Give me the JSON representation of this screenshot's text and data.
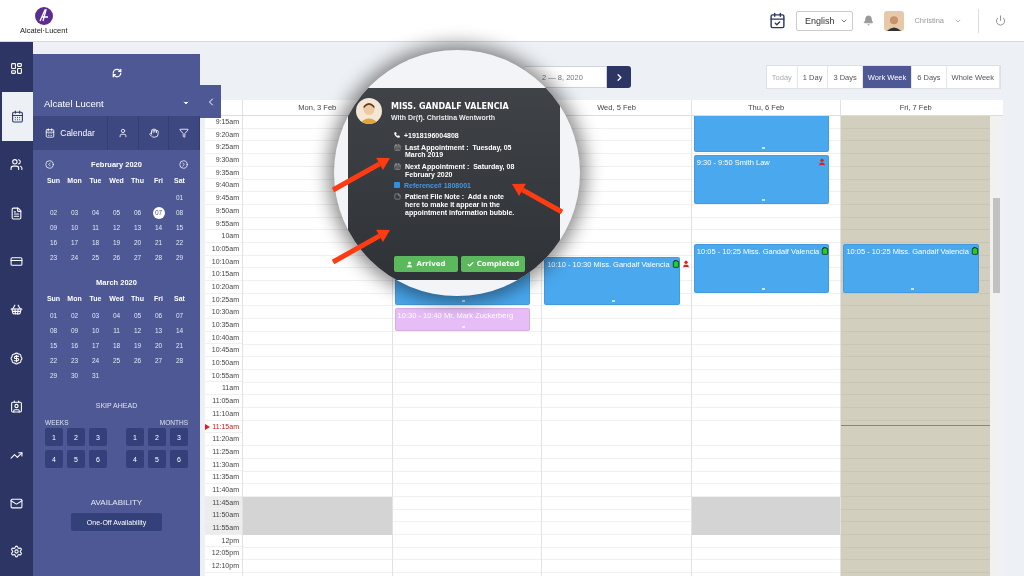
{
  "header": {
    "logo_text": "Alcatel·Lucent",
    "language": "English",
    "user": "Christina"
  },
  "nav_rail": [
    {
      "kind": "dashboard",
      "selected": false
    },
    {
      "kind": "calendar",
      "selected": true
    },
    {
      "kind": "people",
      "selected": false
    },
    {
      "kind": "list",
      "selected": false
    },
    {
      "kind": "card",
      "selected": false
    },
    {
      "kind": "basket",
      "selected": false
    },
    {
      "kind": "dollar",
      "selected": false
    },
    {
      "kind": "contact",
      "selected": false
    },
    {
      "kind": "chart",
      "selected": false
    },
    {
      "kind": "mail",
      "selected": false
    },
    {
      "kind": "settings",
      "selected": false
    }
  ],
  "side_panel": {
    "organization": "Alcatel Lucent",
    "tools": [
      {
        "kind": "calendar",
        "label": "Calendar"
      },
      {
        "kind": "person"
      },
      {
        "kind": "hand"
      },
      {
        "kind": "filter"
      }
    ],
    "mini_calendars": [
      {
        "title": "February 2020",
        "arrows": true,
        "weekdays": [
          "Sun",
          "Mon",
          "Tue",
          "Wed",
          "Thu",
          "Fri",
          "Sat"
        ],
        "weeks": [
          [
            {
              "d": "01",
              "selected": false
            }
          ],
          [
            {
              "d": "02",
              "selected": false
            },
            {
              "d": "03",
              "selected": false
            },
            {
              "d": "04",
              "selected": false
            },
            {
              "d": "05",
              "selected": false
            },
            {
              "d": "06",
              "selected": false
            },
            {
              "d": "07",
              "selected": true
            },
            {
              "d": "08",
              "selected": false
            }
          ],
          [
            {
              "d": "09",
              "selected": false
            },
            {
              "d": "10",
              "selected": false
            },
            {
              "d": "11",
              "selected": false
            },
            {
              "d": "12",
              "selected": false
            },
            {
              "d": "13",
              "selected": false
            },
            {
              "d": "14",
              "selected": false
            },
            {
              "d": "15",
              "selected": false
            }
          ],
          [
            {
              "d": "16",
              "selected": false
            },
            {
              "d": "17",
              "selected": false
            },
            {
              "d": "18",
              "selected": false
            },
            {
              "d": "19",
              "selected": false
            },
            {
              "d": "20",
              "selected": false
            },
            {
              "d": "21",
              "selected": false
            },
            {
              "d": "22",
              "selected": false
            }
          ],
          [
            {
              "d": "23",
              "selected": false
            },
            {
              "d": "24",
              "selected": false
            },
            {
              "d": "25",
              "selected": false
            },
            {
              "d": "26",
              "selected": false
            },
            {
              "d": "27",
              "selected": false
            },
            {
              "d": "28",
              "selected": false
            },
            {
              "d": "29",
              "selected": false
            }
          ]
        ]
      },
      {
        "title": "March 2020",
        "arrows": false,
        "weekdays": [
          "Sun",
          "Mon",
          "Tue",
          "Wed",
          "Thu",
          "Fri",
          "Sat"
        ],
        "weeks": [
          [
            {
              "d": "01",
              "selected": false
            },
            {
              "d": "02",
              "selected": false
            },
            {
              "d": "03",
              "selected": false
            },
            {
              "d": "04",
              "selected": false
            },
            {
              "d": "05",
              "selected": false
            },
            {
              "d": "06",
              "selected": false
            },
            {
              "d": "07",
              "selected": false
            }
          ],
          [
            {
              "d": "08",
              "selected": false
            },
            {
              "d": "09",
              "selected": false
            },
            {
              "d": "10",
              "selected": false
            },
            {
              "d": "11",
              "selected": false
            },
            {
              "d": "12",
              "selected": false
            },
            {
              "d": "13",
              "selected": false
            },
            {
              "d": "14",
              "selected": false
            }
          ],
          [
            {
              "d": "15",
              "selected": false
            },
            {
              "d": "16",
              "selected": false
            },
            {
              "d": "17",
              "selected": false
            },
            {
              "d": "18",
              "selected": false
            },
            {
              "d": "19",
              "selected": false
            },
            {
              "d": "20",
              "selected": false
            },
            {
              "d": "21",
              "selected": false
            }
          ],
          [
            {
              "d": "22",
              "selected": false
            },
            {
              "d": "23",
              "selected": false
            },
            {
              "d": "24",
              "selected": false
            },
            {
              "d": "25",
              "selected": false
            },
            {
              "d": "26",
              "selected": false
            },
            {
              "d": "27",
              "selected": false
            },
            {
              "d": "28",
              "selected": false
            }
          ],
          [
            {
              "d": "29",
              "selected": false
            },
            {
              "d": "30",
              "selected": false
            },
            {
              "d": "31",
              "selected": false
            }
          ]
        ]
      }
    ],
    "skip_ahead": {
      "title": "SKIP AHEAD",
      "weeks_label": "WEEKS",
      "months_label": "MONTHS",
      "weeks": [
        "1",
        "2",
        "3",
        "4",
        "5",
        "6"
      ],
      "months": [
        "1",
        "2",
        "3",
        "4",
        "5",
        "6"
      ]
    },
    "availability": {
      "title": "AVAILABILITY",
      "button": "One-Off Availability"
    }
  },
  "toolbar": {
    "date_range": "2 — 8, 2020",
    "views": [
      {
        "label": "Today",
        "selected": false,
        "disabled": true
      },
      {
        "label": "1 Day",
        "selected": false,
        "disabled": false
      },
      {
        "label": "3 Days",
        "selected": false,
        "disabled": false
      },
      {
        "label": "Work Week",
        "selected": true,
        "disabled": false
      },
      {
        "label": "6 Days",
        "selected": false,
        "disabled": false
      },
      {
        "label": "Whole Week",
        "selected": false,
        "disabled": false
      }
    ]
  },
  "calendar": {
    "times": [
      {
        "label": "9:15am",
        "current": false,
        "blocked": false
      },
      {
        "label": "9:20am",
        "current": false,
        "blocked": false
      },
      {
        "label": "9:25am",
        "current": false,
        "blocked": false
      },
      {
        "label": "9:30am",
        "current": false,
        "blocked": false
      },
      {
        "label": "9:35am",
        "current": false,
        "blocked": false
      },
      {
        "label": "9:40am",
        "current": false,
        "blocked": false
      },
      {
        "label": "9:45am",
        "current": false,
        "blocked": false
      },
      {
        "label": "9:50am",
        "current": false,
        "blocked": false
      },
      {
        "label": "9:55am",
        "current": false,
        "blocked": false
      },
      {
        "label": "10am",
        "current": false,
        "blocked": false
      },
      {
        "label": "10:05am",
        "current": false,
        "blocked": false
      },
      {
        "label": "10:10am",
        "current": false,
        "blocked": false
      },
      {
        "label": "10:15am",
        "current": false,
        "blocked": false
      },
      {
        "label": "10:20am",
        "current": false,
        "blocked": false
      },
      {
        "label": "10:25am",
        "current": false,
        "blocked": false
      },
      {
        "label": "10:30am",
        "current": false,
        "blocked": false
      },
      {
        "label": "10:35am",
        "current": false,
        "blocked": false
      },
      {
        "label": "10:40am",
        "current": false,
        "blocked": false
      },
      {
        "label": "10:45am",
        "current": false,
        "blocked": false
      },
      {
        "label": "10:50am",
        "current": false,
        "blocked": false
      },
      {
        "label": "10:55am",
        "current": false,
        "blocked": false
      },
      {
        "label": "11am",
        "current": false,
        "blocked": false
      },
      {
        "label": "11:05am",
        "current": false,
        "blocked": false
      },
      {
        "label": "11:10am",
        "current": false,
        "blocked": false
      },
      {
        "label": "11:15am",
        "current": true,
        "blocked": false
      },
      {
        "label": "11:20am",
        "current": false,
        "blocked": false
      },
      {
        "label": "11:25am",
        "current": false,
        "blocked": false
      },
      {
        "label": "11:30am",
        "current": false,
        "blocked": false
      },
      {
        "label": "11:35am",
        "current": false,
        "blocked": false
      },
      {
        "label": "11:40am",
        "current": false,
        "blocked": false
      },
      {
        "label": "11:45am",
        "current": false,
        "blocked": true
      },
      {
        "label": "11:50am",
        "current": false,
        "blocked": true
      },
      {
        "label": "11:55am",
        "current": false,
        "blocked": true
      },
      {
        "label": "12pm",
        "current": false,
        "blocked": false
      },
      {
        "label": "12:05pm",
        "current": false,
        "blocked": false
      },
      {
        "label": "12:10pm",
        "current": false,
        "blocked": false
      }
    ],
    "days": [
      {
        "label": "Mon, 3 Feb",
        "unavailable": false,
        "shows_blocked": true
      },
      {
        "unavailable": false,
        "shows_blocked": false,
        "events": [
          {
            "kind": "continued",
            "color": "#4aa8ee"
          },
          {
            "kind": "appointment",
            "time": "10:30 - 10:40",
            "title": "Mr. Mark Zuckerberg",
            "color": "#e6bdf7"
          }
        ]
      },
      {
        "label": "Wed, 5 Feb",
        "unavailable": false,
        "shows_blocked": false,
        "events": [
          {
            "kind": "appointment",
            "time": "10:10 - 10:30",
            "title": "Miss. Gandalf Valencia",
            "color": "#4aa8ee",
            "badges": [
              {
                "kind": "clipboard"
              },
              {
                "kind": "person"
              }
            ]
          }
        ]
      },
      {
        "label": "Thu, 6 Feb",
        "unavailable": false,
        "shows_blocked": true,
        "events": [
          {
            "kind": "continued",
            "color": "#4aa8ee"
          },
          {
            "kind": "appointment",
            "time": "9:30 - 9:50",
            "title": "Smith Law",
            "color": "#4aa8ee",
            "badges": [
              {
                "kind": "person"
              }
            ]
          },
          {
            "kind": "appointment",
            "time": "10:05 - 10:25",
            "title": "Miss. Gandalf Valencia",
            "color": "#4aa8ee",
            "badges": [
              {
                "kind": "clipboard"
              }
            ]
          }
        ]
      },
      {
        "label": "Fri, 7 Feb",
        "unavailable": true,
        "shows_blocked": false,
        "events": [
          {
            "kind": "appointment",
            "time": "10:05 - 10:25",
            "title": "Miss. Gandalf Valencia",
            "color": "#4aa8ee",
            "badges": [
              {
                "kind": "clipboard"
              }
            ]
          }
        ]
      }
    ]
  },
  "popup": {
    "name": "MISS. GANDALF VALENCIA",
    "with": "With Dr(f). Christina Wentworth",
    "phone": "+1918196004808",
    "details": [
      {
        "label": "Last Appointment :",
        "value": "Tuesday, 05 March 2019"
      },
      {
        "label": "Next Appointment :",
        "value": "Saturday, 08 February 2020"
      }
    ],
    "reference": "Reference# 1808001",
    "note_label": "Patient File Note :",
    "note": "Add a note here to make it appear in the appointment information bubble.",
    "buttons": [
      {
        "kind": "arrived",
        "label": "Arrived"
      },
      {
        "kind": "completed",
        "label": "Completed"
      }
    ]
  }
}
